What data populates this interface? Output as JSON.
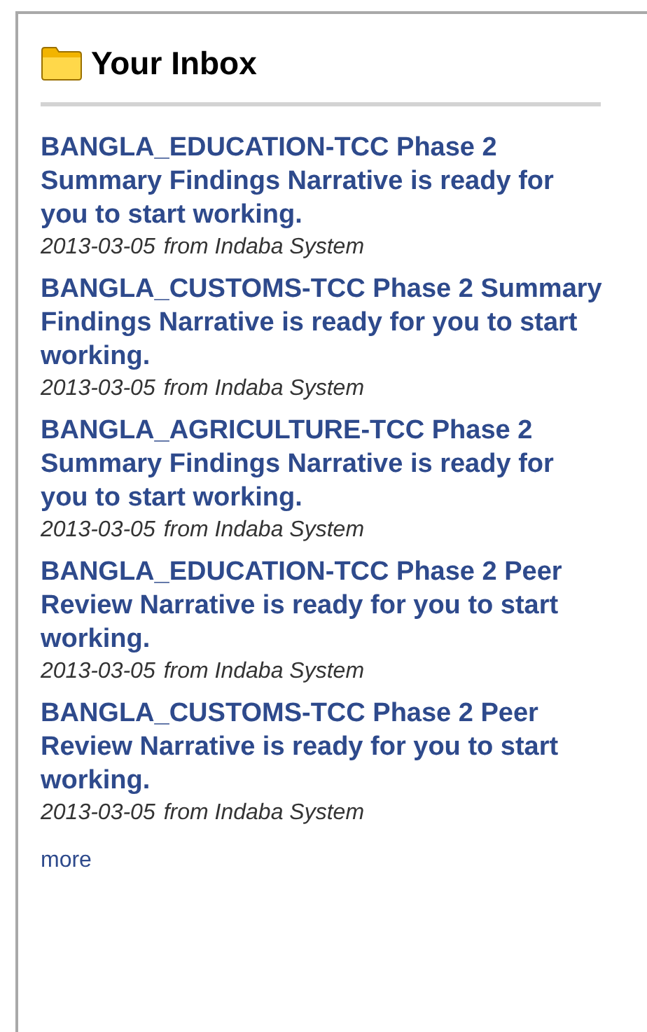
{
  "panel": {
    "title": "Your Inbox"
  },
  "messages": [
    {
      "subject": "BANGLA_EDUCATION-TCC Phase 2 Summary Findings Narrative is ready for you to start working.",
      "date": "2013-03-05",
      "sender": "from Indaba System"
    },
    {
      "subject": "BANGLA_CUSTOMS-TCC Phase 2 Summary Findings Narrative is ready for you to start working.",
      "date": "2013-03-05",
      "sender": "from Indaba System"
    },
    {
      "subject": "BANGLA_AGRICULTURE-TCC Phase 2 Summary Findings Narrative is ready for you to start working.",
      "date": "2013-03-05",
      "sender": "from Indaba System"
    },
    {
      "subject": "BANGLA_EDUCATION-TCC Phase 2 Peer Review Narrative is ready for you to start working.",
      "date": "2013-03-05",
      "sender": "from Indaba System"
    },
    {
      "subject": "BANGLA_CUSTOMS-TCC Phase 2 Peer Review Narrative is ready for you to start working.",
      "date": "2013-03-05",
      "sender": "from Indaba System"
    }
  ],
  "more_link": "more"
}
